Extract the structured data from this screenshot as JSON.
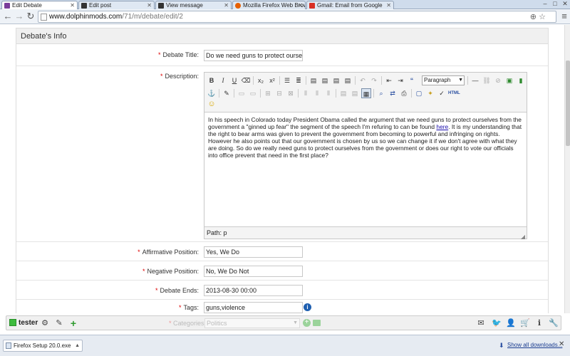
{
  "browser": {
    "tabs": [
      {
        "label": "Edit Debate",
        "active": true,
        "icon_color": "#7a3d9a"
      },
      {
        "label": "Edit post",
        "active": false,
        "icon_color": "#333333"
      },
      {
        "label": "View message",
        "active": false,
        "icon_color": "#333333"
      },
      {
        "label": "Mozilla Firefox Web Brows",
        "active": false,
        "icon_color": "#e66000"
      },
      {
        "label": "Gmail: Email from Google",
        "active": false,
        "icon_color": "#d93025"
      }
    ],
    "url_host": "www.dolphinmods.com",
    "url_path": "/71/m/debate/edit/2"
  },
  "form": {
    "section_title": "Debate's Info",
    "debate_title_label": "Debate Title:",
    "debate_title_value": "Do we need guns to protect ourselves",
    "description_label": "Description:",
    "format_select_value": "Paragraph",
    "editor_text_before_link": "In his speech in Colorado today President Obama called the argument that we need guns to protect ourselves from the government a \"ginned up fear\" the segment of the speech I'm refuring to can be found ",
    "editor_link_text": "here",
    "editor_text_after_link": ". It is my understanding that the right to bear arms was given to prevent the government from becoming to powerful and infringing on rights. However he also points out that our government is chosen by us so we can change it if we don't agree with what they are doing. So do we really need guns to protect ourselves from the government or does our right to vote our officials into office prevent that need in the first place?",
    "editor_path": "Path: p",
    "affirmative_label": "Affirmative Position:",
    "affirmative_value": "Yes, We Do",
    "negative_label": "Negative Position:",
    "negative_value": "No, We Do Not",
    "ends_label": "Debate Ends:",
    "ends_value": "2013-08-30 00:00",
    "tags_label": "Tags:",
    "tags_value": "guns,violence",
    "categories_label": "Categories",
    "categories_value": "Politics"
  },
  "sitebar": {
    "username": "tester",
    "status_color": "#3dbb3d"
  },
  "downloads": {
    "file_label": "Firefox Setup 20.0.exe",
    "show_all": "Show all downloads..."
  }
}
